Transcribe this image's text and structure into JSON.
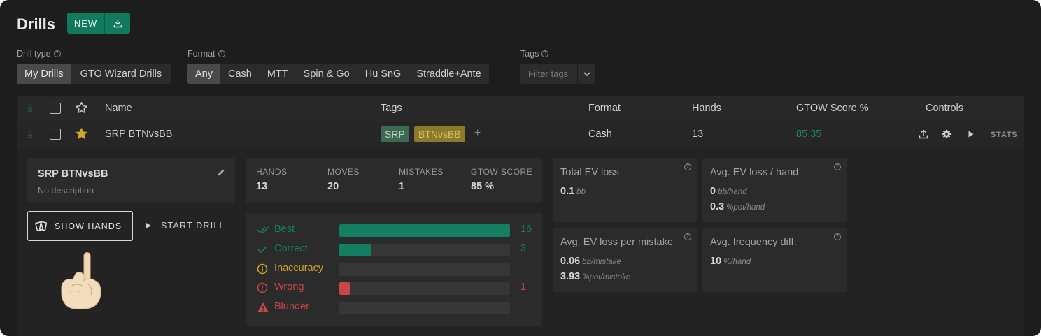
{
  "header": {
    "title": "Drills",
    "new_label": "NEW"
  },
  "filters": {
    "drill_type": {
      "label": "Drill type",
      "options": [
        "My Drills",
        "GTO Wizard Drills"
      ],
      "selected": "My Drills"
    },
    "format": {
      "label": "Format",
      "options": [
        "Any",
        "Cash",
        "MTT",
        "Spin & Go",
        "Hu SnG",
        "Straddle+Ante"
      ],
      "selected": "Any"
    },
    "tags": {
      "label": "Tags",
      "placeholder": "Filter tags"
    }
  },
  "table": {
    "columns": {
      "name": "Name",
      "tags": "Tags",
      "format": "Format",
      "hands": "Hands",
      "score": "GTOW Score %",
      "controls": "Controls"
    },
    "row": {
      "name": "SRP BTNvsBB",
      "tags": [
        "SRP",
        "BTNvsBB"
      ],
      "add_tag": "+",
      "format": "Cash",
      "hands": "13",
      "score": "85.35",
      "stats_label": "STATS",
      "starred": true
    }
  },
  "detail": {
    "name": "SRP BTNvsBB",
    "description": "No description",
    "show_hands_label": "SHOW HANDS",
    "start_drill_label": "START DRILL",
    "summary": [
      {
        "label": "HANDS",
        "value": "13"
      },
      {
        "label": "MOVES",
        "value": "20"
      },
      {
        "label": "MISTAKES",
        "value": "1"
      },
      {
        "label": "GTOW SCORE",
        "value": "85 %"
      }
    ],
    "results": [
      {
        "label": "Best",
        "count": "16",
        "fraction": 1.0,
        "color": "#137e61"
      },
      {
        "label": "Correct",
        "count": "3",
        "fraction": 0.19,
        "color": "#137e61"
      },
      {
        "label": "Inaccuracy",
        "count": "",
        "fraction": 0,
        "color": "#d4a52a"
      },
      {
        "label": "Wrong",
        "count": "1",
        "fraction": 0.06,
        "color": "#c94646"
      },
      {
        "label": "Blunder",
        "count": "",
        "fraction": 0,
        "color": "#c94646"
      }
    ],
    "metrics": {
      "total_ev": {
        "title": "Total EV loss",
        "v1": "0.1",
        "u1": "bb"
      },
      "avg_ev_hand": {
        "title": "Avg. EV loss / hand",
        "v1": "0",
        "u1": "bb/hand",
        "v2": "0.3",
        "u2": "%pot/hand"
      },
      "avg_ev_mistake": {
        "title": "Avg. EV loss per mistake",
        "v1": "0.06",
        "u1": "bb/mistake",
        "v2": "3.93",
        "u2": "%pot/mistake"
      },
      "avg_freq": {
        "title": "Avg. frequency diff.",
        "v1": "10",
        "u1": "%/hand"
      }
    }
  },
  "colors": {
    "accent": "#0f7a5e",
    "score": "#1b8a68",
    "star": "#d4a52a",
    "wrong": "#c94646"
  }
}
